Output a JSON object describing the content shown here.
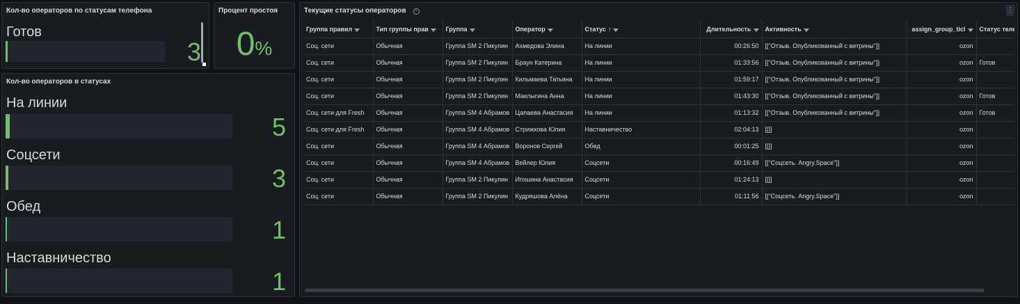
{
  "phone_panel": {
    "title": "Кол-во операторов по статусам телефона",
    "items": [
      {
        "label": "Готов",
        "value": "3",
        "fill": 0.01
      }
    ]
  },
  "idle_panel": {
    "title": "Процент простоя",
    "value": "0",
    "unit": "%"
  },
  "status_panel": {
    "title": "Кол-во операторов в статусах",
    "items": [
      {
        "label": "На линии",
        "value": "5",
        "fill": 0.02
      },
      {
        "label": "Соцсети",
        "value": "3",
        "fill": 0.012
      },
      {
        "label": "Обед",
        "value": "1",
        "fill": 0.004
      },
      {
        "label": "Наставничество",
        "value": "1",
        "fill": 0.004
      }
    ]
  },
  "table_panel": {
    "title": "Текущие статусы операторов",
    "info_icon": "info-icon",
    "menu_icon": "⋮",
    "columns": [
      "Группа правил",
      "Тип группы прав",
      "Группа",
      "Оператор",
      "Статус",
      "Длительность",
      "Активность",
      "assign_group_ticl",
      "Статус теле"
    ],
    "sort_column": "Статус",
    "rows": [
      [
        "Соц. сети",
        "Обычная",
        "Группа SM 2 Пикулин",
        "Ахмедова Элина",
        "На линии",
        "00:26:50",
        "[[\"Отзыв. Опубликованный с витрины\"]]",
        "ozon",
        ""
      ],
      [
        "Соц. сети",
        "Обычная",
        "Группа SM 2 Пикулин",
        "Браун Катерина",
        "На линии",
        "01:33:56",
        "[[\"Отзыв. Опубликованный с витрины\"]]",
        "ozon",
        "Готов"
      ],
      [
        "Соц. сети",
        "Обычная",
        "Группа SM 2 Пикулин",
        "Кильмаева Татьяна",
        "На линии",
        "01:59:17",
        "[[\"Отзыв. Опубликованный с витрины\"]]",
        "ozon",
        ""
      ],
      [
        "Соц. сети",
        "Обычная",
        "Группа SM 2 Пикулин",
        "Маклыгина Анна",
        "На линии",
        "01:43:30",
        "[[\"Отзыв. Опубликованный с витрины\"]]",
        "ozon",
        "Готов"
      ],
      [
        "Соц. сети для Fresh",
        "Обычная",
        "Группа SM 4 Абрамов",
        "Цапаева Анастасия",
        "На линии",
        "01:13:32",
        "[[\"Отзыв. Опубликованный с витрины\"]]",
        "ozon",
        "Готов"
      ],
      [
        "Соц. сети для Fresh",
        "Обычная",
        "Группа SM 4 Абрамов",
        "Стрижкова Юлия",
        "Наставничество",
        "02:04:13",
        "[[]]",
        "ozon",
        ""
      ],
      [
        "Соц. сети",
        "Обычная",
        "Группа SM 4 Абрамов",
        "Воронов Сергей",
        "Обед",
        "00:01:25",
        "[[]]",
        "ozon",
        ""
      ],
      [
        "Соц. сети",
        "Обычная",
        "Группа SM 4 Абрамов",
        "Вейлер Юлия",
        "Соцсети",
        "00:16:49",
        "[[\"Соцсеть. Angry.Space\"]]",
        "ozon",
        ""
      ],
      [
        "Соц. сети",
        "Обычная",
        "Группа SM 2 Пикулин",
        "Игошина Анастасия",
        "Соцсети",
        "01:24:13",
        "[[]]",
        "ozon",
        ""
      ],
      [
        "Соц. сети",
        "Обычная",
        "Группа SM 2 Пикулин",
        "Кудряшова Алёна",
        "Соцсети",
        "01:11:56",
        "[[\"Соцсеть. Angry.Space\"]]",
        "ozon",
        ""
      ]
    ]
  },
  "colors": {
    "background": "#111217",
    "panel": "#181b1f",
    "accent": "#73bf69",
    "track": "#22252b"
  }
}
